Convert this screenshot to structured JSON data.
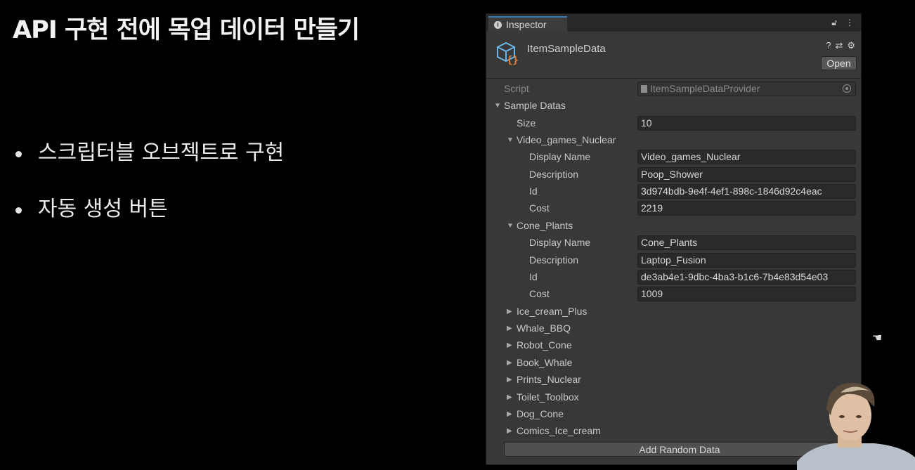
{
  "slide": {
    "title": "API 구현 전에 목업 데이터 만들기",
    "bullets": [
      "스크립터블 오브젝트로 구현",
      "자동 생성 버튼"
    ]
  },
  "inspector": {
    "tab_label": "Inspector",
    "asset_name": "ItemSampleData",
    "open_button": "Open",
    "script_label": "Script",
    "script_value": "ItemSampleDataProvider",
    "sample_datas_label": "Sample Datas",
    "size_label": "Size",
    "size_value": "10",
    "field_labels": {
      "display_name": "Display Name",
      "description": "Description",
      "id": "Id",
      "cost": "Cost"
    },
    "expanded_items": [
      {
        "name": "Video_games_Nuclear",
        "display_name": "Video_games_Nuclear",
        "description": "Poop_Shower",
        "id": "3d974bdb-9e4f-4ef1-898c-1846d92c4eac",
        "cost": "2219"
      },
      {
        "name": "Cone_Plants",
        "display_name": "Cone_Plants",
        "description": "Laptop_Fusion",
        "id": "de3ab4e1-9dbc-4ba3-b1c6-7b4e83d54e03",
        "cost": "1009"
      }
    ],
    "collapsed_items": [
      "Ice_cream_Plus",
      "Whale_BBQ",
      "Robot_Cone",
      "Book_Whale",
      "Prints_Nuclear",
      "Toilet_Toolbox",
      "Dog_Cone",
      "Comics_Ice_cream"
    ],
    "add_button": "Add Random Data"
  },
  "colors": {
    "accent": "#3a79bb",
    "panel_bg": "#383838",
    "field_bg": "#2a2a2a"
  }
}
